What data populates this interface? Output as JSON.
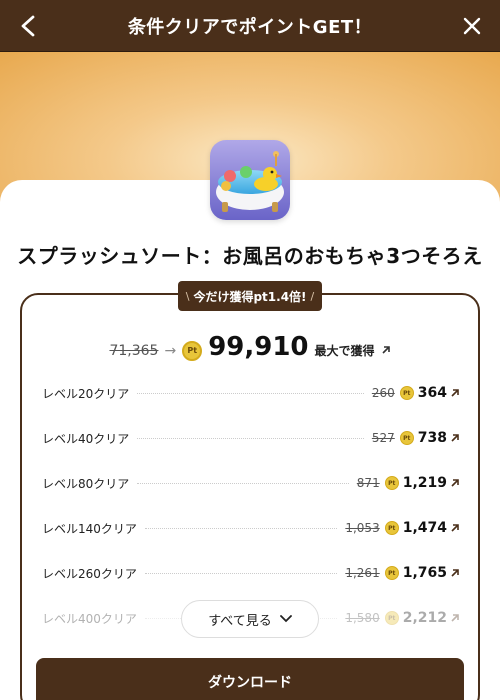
{
  "header": {
    "title": "条件クリアでポイントGET！",
    "back_icon": "chevron-left-icon",
    "close_icon": "close-icon"
  },
  "game": {
    "title": "スプラッシュソート：お風呂のおもちゃ3つそろえ",
    "icon": "bathtub-duck-app-icon"
  },
  "boost": {
    "label": "今だけ獲得pt1.4倍!",
    "left_mark": "\\",
    "right_mark": "/"
  },
  "total": {
    "old": "71,365",
    "new": "99,910",
    "suffix": "最大で獲得"
  },
  "levels": [
    {
      "label": "レベル20クリア",
      "old": "260",
      "new": "364"
    },
    {
      "label": "レベル40クリア",
      "old": "527",
      "new": "738"
    },
    {
      "label": "レベル80クリア",
      "old": "871",
      "new": "1,219"
    },
    {
      "label": "レベル140クリア",
      "old": "1,053",
      "new": "1,474"
    },
    {
      "label": "レベル260クリア",
      "old": "1,261",
      "new": "1,765"
    },
    {
      "label": "レベル400クリア",
      "old": "1,580",
      "new": "2,212"
    }
  ],
  "see_all": {
    "label": "すべて見る"
  },
  "download": {
    "label": "ダウンロード"
  },
  "colors": {
    "brand_brown": "#4a2f1a",
    "coin_gold": "#e8c53a",
    "banner_orange": "#e8a94f"
  },
  "coin_text": "Pt"
}
